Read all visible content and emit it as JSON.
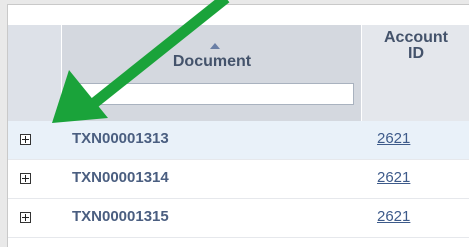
{
  "table": {
    "columns": {
      "document": "Document",
      "account_id": "Account\nID"
    },
    "filter": {
      "value": "",
      "placeholder": ""
    },
    "rows": [
      {
        "document": "TXN00001313",
        "account_id": "2621"
      },
      {
        "document": "TXN00001314",
        "account_id": "2621"
      },
      {
        "document": "TXN00001315",
        "account_id": "2621"
      }
    ]
  },
  "icons": {
    "sort": "sort-ascending-icon",
    "expand": "expand-plus-icon",
    "annotation": "green-arrow-icon"
  },
  "colors": {
    "header_bg": "#d4d8df",
    "header_text": "#44536b",
    "selected_row_bg": "#e9f1f9",
    "link": "#3d5a8a",
    "annotation_arrow": "#1aa33a"
  }
}
